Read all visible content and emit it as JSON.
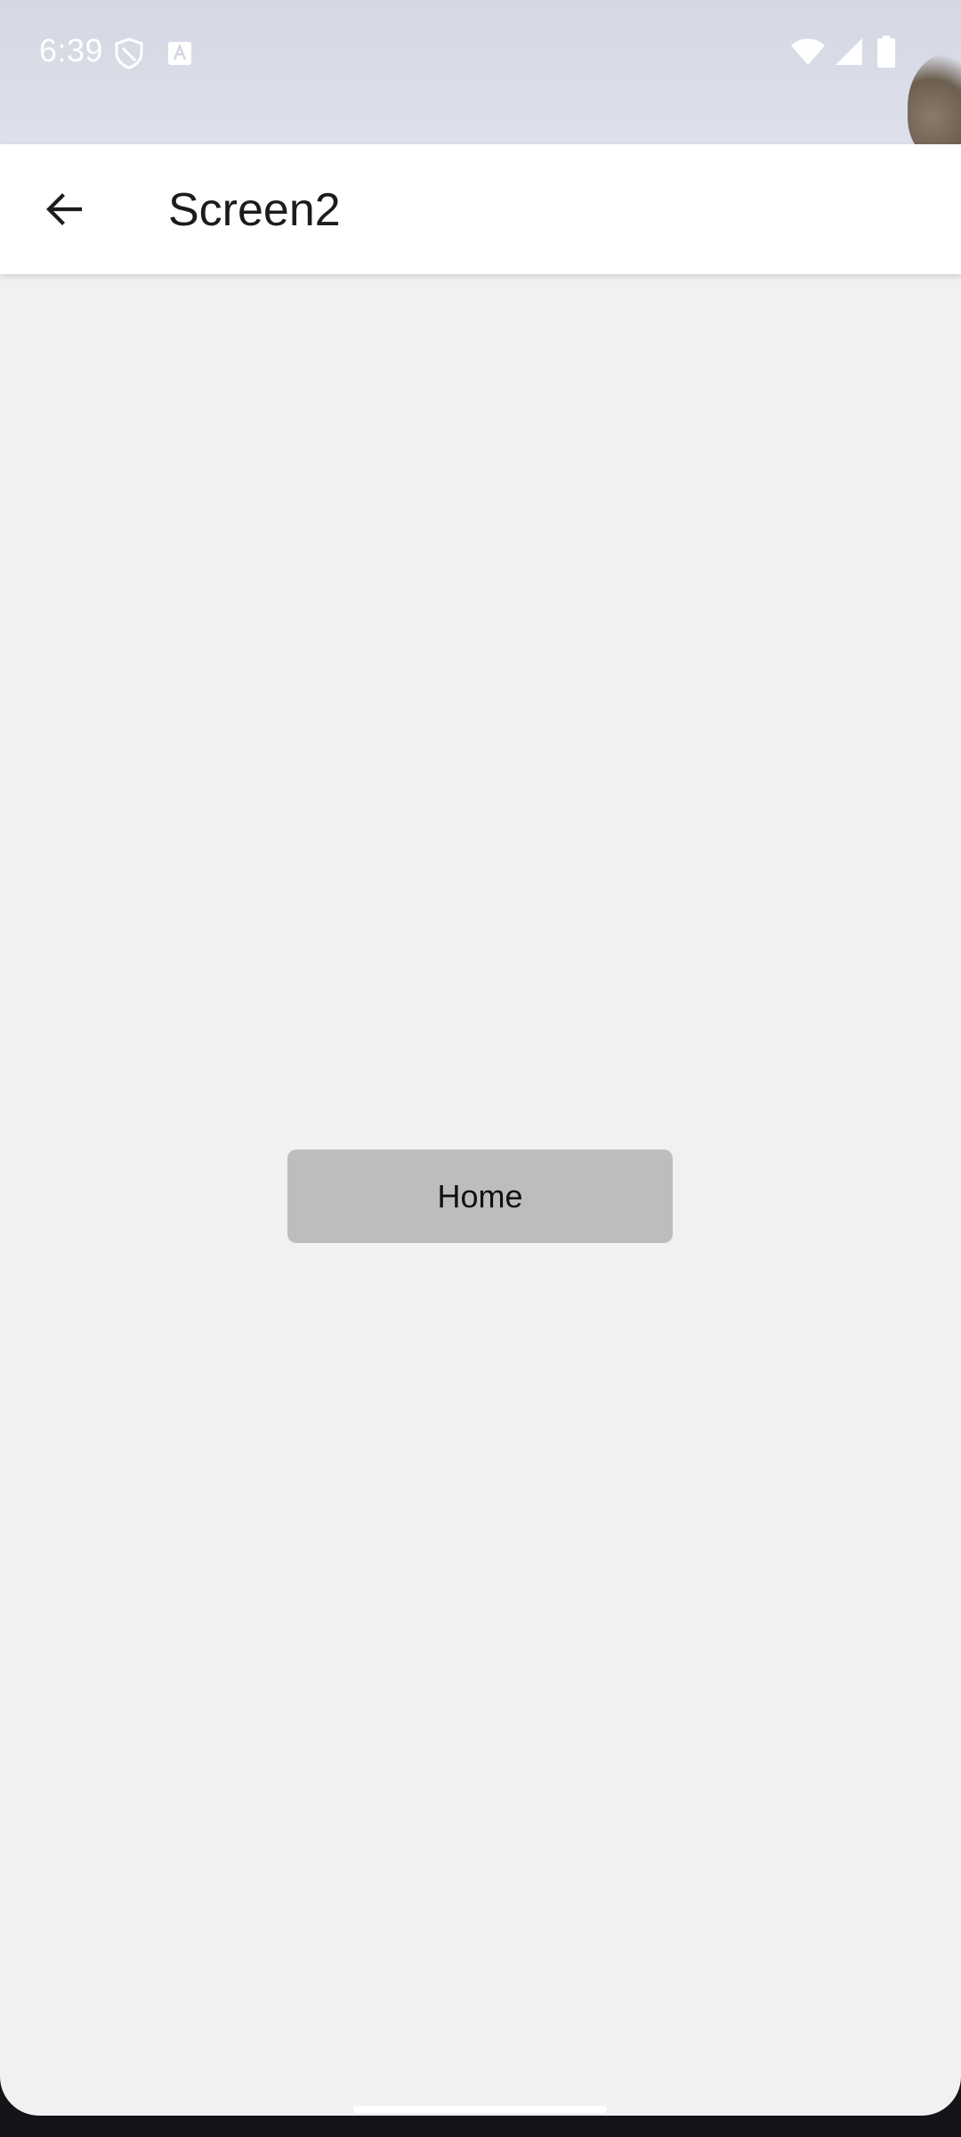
{
  "status_bar": {
    "time": "6:39",
    "icons": [
      "shield-icon",
      "a-icon",
      "wifi-icon",
      "signal-icon",
      "battery-icon"
    ]
  },
  "app_bar": {
    "title": "Screen2",
    "back_icon": "arrow-left-icon"
  },
  "main": {
    "home_button_label": "Home"
  },
  "colors": {
    "background": "#f1f1f1",
    "app_bar": "#ffffff",
    "button": "#bdbdbd",
    "text": "#1c1c1c"
  }
}
